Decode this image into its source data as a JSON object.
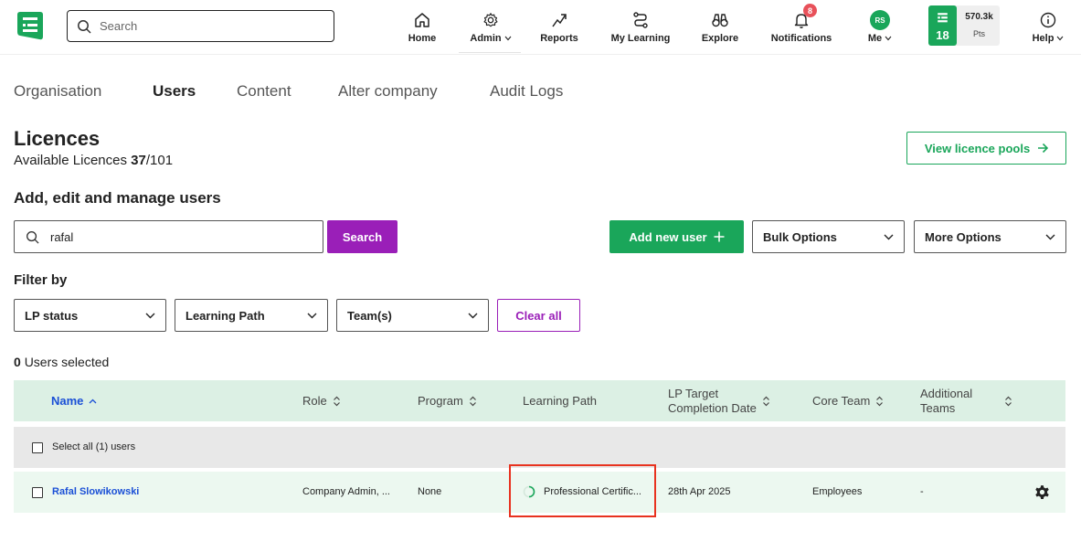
{
  "nav": {
    "search_placeholder": "Search",
    "items": [
      {
        "label": "Home",
        "icon": "home-icon"
      },
      {
        "label": "Admin",
        "icon": "gear-icon",
        "has_menu": true
      },
      {
        "label": "Reports",
        "icon": "trend-up-icon"
      },
      {
        "label": "My Learning",
        "icon": "path-icon"
      },
      {
        "label": "Explore",
        "icon": "binoculars-icon"
      },
      {
        "label": "Notifications",
        "icon": "bell-icon",
        "badge": "8"
      },
      {
        "label": "Me",
        "icon": "avatar",
        "has_menu": true,
        "avatar_initials": "RS"
      },
      {
        "label": "Help",
        "icon": "info-icon",
        "has_menu": true
      }
    ],
    "points": {
      "level": "18",
      "value": "570.3k",
      "unit": "Pts"
    }
  },
  "tabs": [
    {
      "label": "Organisation",
      "active": false
    },
    {
      "label": "Users",
      "active": true
    },
    {
      "label": "Content",
      "active": false
    },
    {
      "label": "Alter company",
      "active": false
    },
    {
      "label": "Audit Logs",
      "active": false
    }
  ],
  "licences": {
    "title": "Licences",
    "available_label": "Available Licences",
    "available": "37",
    "total": "/101",
    "pool_button": "View licence pools"
  },
  "manage": {
    "title": "Add, edit and manage users",
    "search_value": "rafal",
    "search_button": "Search",
    "add_button": "Add new user",
    "bulk_options": "Bulk Options",
    "more_options": "More Options"
  },
  "filters": {
    "title": "Filter by",
    "lp_status": "LP status",
    "learning_path": "Learning Path",
    "teams": "Team(s)",
    "clear": "Clear all"
  },
  "selection": {
    "count": "0",
    "label": "Users selected"
  },
  "table": {
    "headers": {
      "name": "Name",
      "role": "Role",
      "program": "Program",
      "learning_path": "Learning Path",
      "lp_target_1": "LP Target",
      "lp_target_2": "Completion Date",
      "core_team": "Core Team",
      "additional_1": "Additional",
      "additional_2": "Teams"
    },
    "select_all": "Select all (1) users",
    "rows": [
      {
        "name": "Rafal Slowikowski",
        "role": "Company Admin, ...",
        "program": "None",
        "learning_path": "Professional Certific...",
        "target_date": "28th Apr 2025",
        "core_team": "Employees",
        "additional_teams": "-"
      }
    ]
  },
  "colors": {
    "brand_green": "#1aa65a",
    "purple": "#9a1fb8",
    "link_blue": "#1a4fd6",
    "highlight_red": "#e8321f"
  }
}
